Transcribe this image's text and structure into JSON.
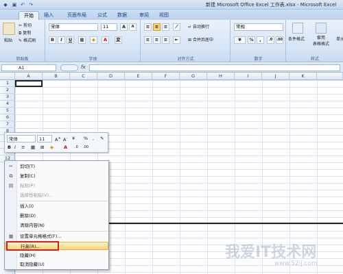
{
  "window": {
    "title": "新建 Microsoft Office Excel 工作表.xlsx - Microsoft Excel"
  },
  "tabs": [
    {
      "label": "开始",
      "active": true
    },
    {
      "label": "插入"
    },
    {
      "label": "页面布局"
    },
    {
      "label": "公式"
    },
    {
      "label": "数据"
    },
    {
      "label": "审阅"
    },
    {
      "label": "视图"
    }
  ],
  "ribbon": {
    "clipboard": {
      "paste": "粘贴",
      "cut": "剪切",
      "copy": "复制",
      "format_painter": "格式刷",
      "label": "剪贴板"
    },
    "font": {
      "name": "宋体",
      "size": "11",
      "label": "字体"
    },
    "alignment": {
      "wrap": "自动换行",
      "merge": "合并后居中",
      "label": "对齐方式"
    },
    "number": {
      "format": "常规",
      "percent": "%",
      "comma": ",",
      "label": "数字"
    },
    "styles": {
      "conditional": "条件格式",
      "table": "套用\n表格格式",
      "cell": "单元",
      "label": "样式"
    }
  },
  "formula_bar": {
    "name_box": "A1",
    "fx": "fx",
    "value": ""
  },
  "columns": [
    "A",
    "B",
    "C",
    "D",
    "E",
    "F",
    "G",
    "H",
    "I",
    "J",
    "K"
  ],
  "rows": [
    "1",
    "2",
    "3",
    "4",
    "5",
    "6",
    "7",
    "8",
    "9",
    "10",
    "11",
    "12"
  ],
  "mini_toolbar": {
    "font": "宋体",
    "size": "11",
    "percent": "%"
  },
  "context_menu": {
    "items": [
      {
        "label": "剪切(T)",
        "icon": "scissors-icon"
      },
      {
        "label": "复制(C)",
        "icon": "copy-icon"
      },
      {
        "label": "粘贴(P)",
        "icon": "paste-icon",
        "disabled": true
      },
      {
        "label": "选择性粘贴(V)...",
        "disabled": true
      },
      {
        "label": "插入(I)"
      },
      {
        "label": "删除(D)"
      },
      {
        "label": "清除内容(N)"
      },
      {
        "label": "设置单元格格式(F)...",
        "icon": "format-cells-icon"
      },
      {
        "label": "行高(R)...",
        "highlighted": true
      },
      {
        "label": "隐藏(H)"
      },
      {
        "label": "取消隐藏(U)"
      }
    ]
  },
  "watermark": {
    "text": "我爱IT技术网",
    "url": "www.52ij.com"
  }
}
